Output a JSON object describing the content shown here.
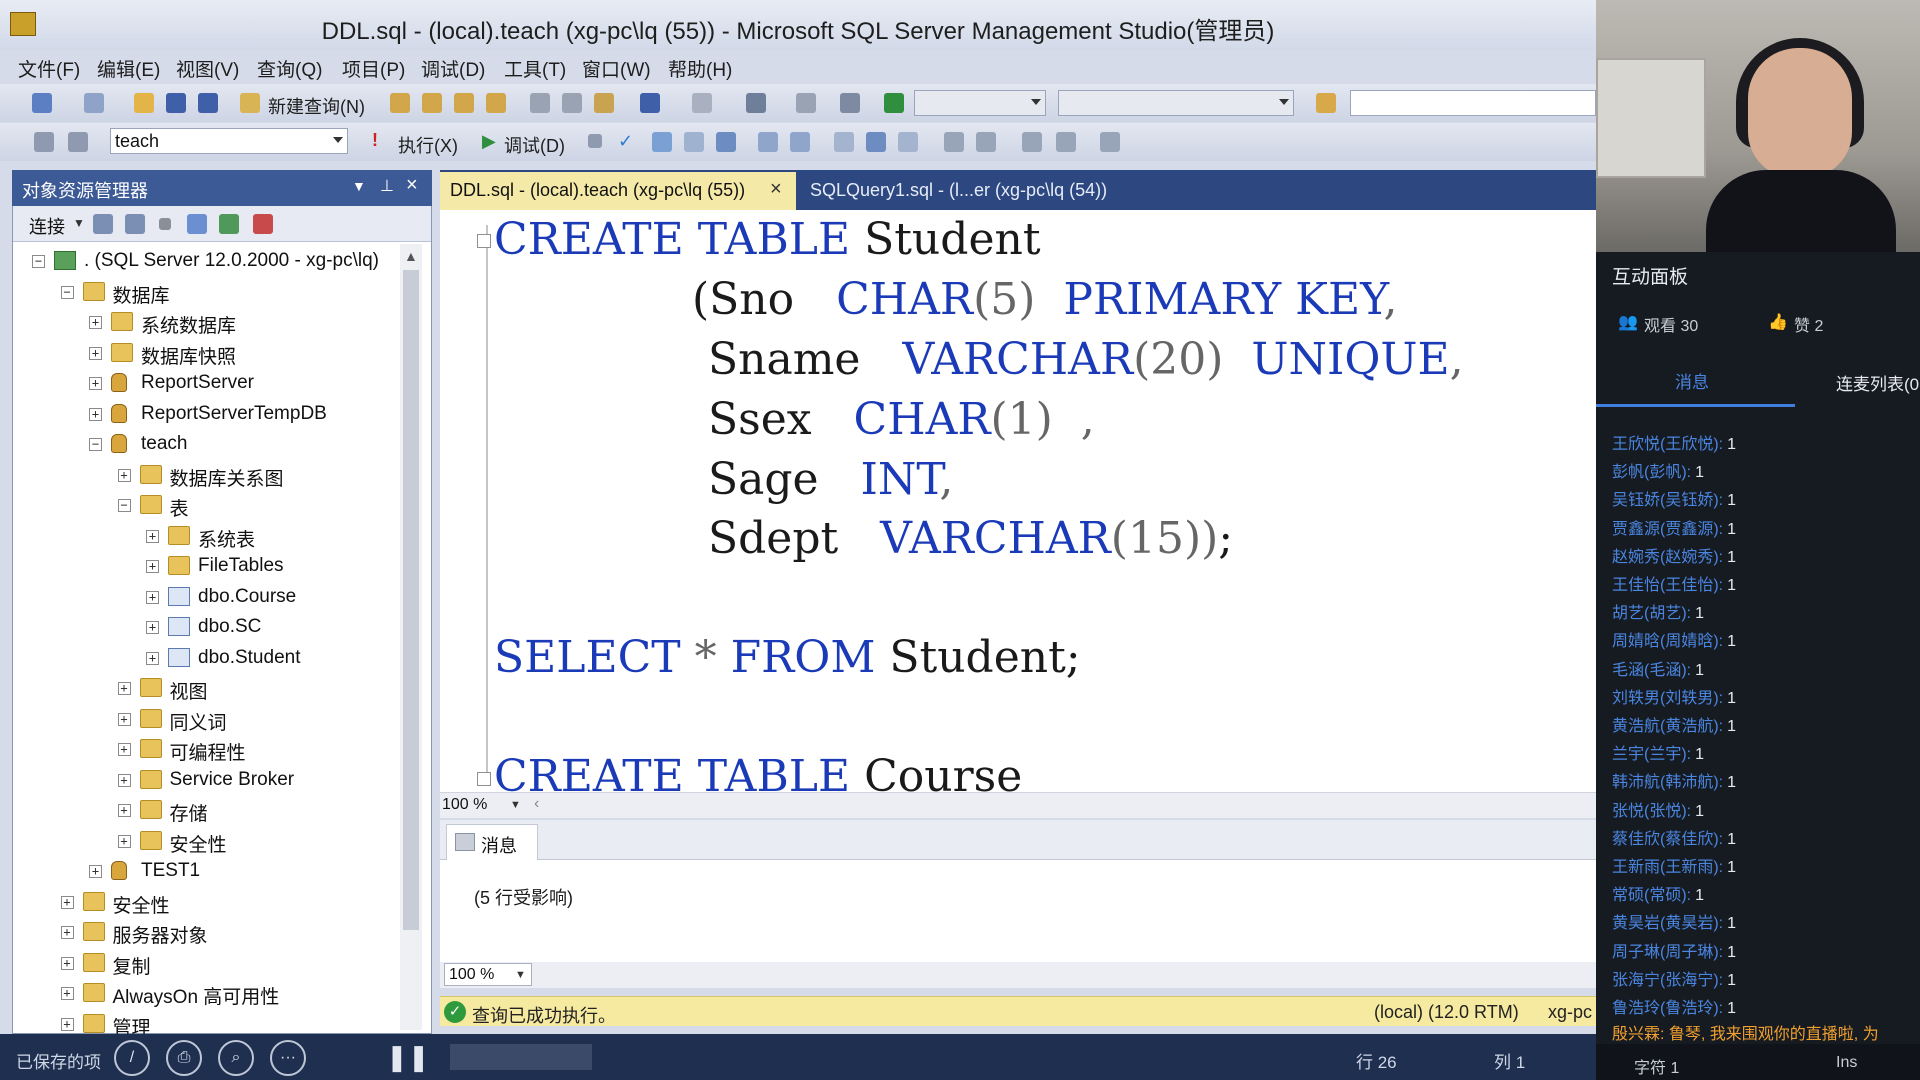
{
  "window": {
    "title": "DDL.sql - (local).teach (xg-pc\\lq (55)) - Microsoft SQL Server Management Studio(管理员)"
  },
  "menu": [
    "文件(F)",
    "编辑(E)",
    "视图(V)",
    "查询(Q)",
    "项目(P)",
    "调试(D)",
    "工具(T)",
    "窗口(W)",
    "帮助(H)"
  ],
  "toolbar": {
    "new_query_label": "新建查询(N)",
    "database": "teach",
    "execute_label": "执行(X)",
    "debug_label": "调试(D)"
  },
  "object_explorer": {
    "title": "对象资源管理器",
    "connect_label": "连接",
    "tree": [
      {
        "label": ". (SQL Server 12.0.2000 - xg-pc\\lq)",
        "expander": "⊟",
        "icon": "server"
      },
      {
        "label": "数据库",
        "expander": "⊟",
        "icon": "folder"
      },
      {
        "label": "系统数据库",
        "expander": "⊞",
        "icon": "folder"
      },
      {
        "label": "数据库快照",
        "expander": "⊞",
        "icon": "folder"
      },
      {
        "label": "ReportServer",
        "expander": "⊞",
        "icon": "db"
      },
      {
        "label": "ReportServerTempDB",
        "expander": "⊞",
        "icon": "db"
      },
      {
        "label": "teach",
        "expander": "⊟",
        "icon": "db"
      },
      {
        "label": "数据库关系图",
        "expander": "⊞",
        "icon": "folder"
      },
      {
        "label": "表",
        "expander": "⊟",
        "icon": "folder"
      },
      {
        "label": "系统表",
        "expander": "⊞",
        "icon": "folder"
      },
      {
        "label": "FileTables",
        "expander": "⊞",
        "icon": "folder"
      },
      {
        "label": "dbo.Course",
        "expander": "⊞",
        "icon": "table"
      },
      {
        "label": "dbo.SC",
        "expander": "⊞",
        "icon": "table"
      },
      {
        "label": "dbo.Student",
        "expander": "⊞",
        "icon": "table"
      },
      {
        "label": "视图",
        "expander": "⊞",
        "icon": "folder"
      },
      {
        "label": "同义词",
        "expander": "⊞",
        "icon": "folder"
      },
      {
        "label": "可编程性",
        "expander": "⊞",
        "icon": "folder"
      },
      {
        "label": "Service Broker",
        "expander": "⊞",
        "icon": "folder"
      },
      {
        "label": "存储",
        "expander": "⊞",
        "icon": "folder"
      },
      {
        "label": "安全性",
        "expander": "⊞",
        "icon": "folder"
      },
      {
        "label": "TEST1",
        "expander": "⊞",
        "icon": "db"
      },
      {
        "label": "安全性",
        "expander": "⊞",
        "icon": "folder"
      },
      {
        "label": "服务器对象",
        "expander": "⊞",
        "icon": "folder"
      },
      {
        "label": "复制",
        "expander": "⊞",
        "icon": "folder"
      },
      {
        "label": "AlwaysOn 高可用性",
        "expander": "⊞",
        "icon": "folder"
      },
      {
        "label": "管理",
        "expander": "⊞",
        "icon": "folder"
      }
    ]
  },
  "editor": {
    "tabs": [
      {
        "label": "DDL.sql - (local).teach (xg-pc\\lq (55))",
        "close": "×"
      },
      {
        "label": "SQLQuery1.sql - (l...er (xg-pc\\lq (54))"
      }
    ],
    "fold_markers": [
      "⊟",
      "⊟"
    ],
    "code": {
      "l1": {
        "kw1": "CREATE TABLE",
        "txt": " Student"
      },
      "l2": {
        "a": "(Sno   ",
        "kw1": "CHAR",
        "b": "(5)  ",
        "kw2": "PRIMARY KEY",
        "c": ","
      },
      "l3": {
        "a": "Sname   ",
        "kw1": "VARCHAR",
        "b": "(20)  ",
        "kw2": "UNIQUE",
        "c": ","
      },
      "l4": {
        "a": "Ssex   ",
        "kw1": "CHAR",
        "b": "(1)  ,"
      },
      "l5": {
        "a": "Sage   ",
        "kw1": "INT",
        "b": ","
      },
      "l6": {
        "a": "Sdept   ",
        "kw1": "VARCHAR",
        "b": "(15))",
        "c": ";"
      },
      "l7": {
        "kw1": "SELECT",
        "b": " * ",
        "kw2": "FROM",
        "c": " Student;"
      },
      "l8": {
        "kw1": "CREATE TABLE",
        "txt": " Course"
      }
    },
    "zoom": "100 %"
  },
  "results": {
    "tab_label": "消息",
    "message": "(5 行受影响)",
    "zoom": "100 %"
  },
  "statusbar": {
    "ok_icon": "✓",
    "message": "查询已成功执行。",
    "server": "(local) (12.0 RTM)",
    "user": "xg-pc"
  },
  "bottombar": {
    "saved_label": "已保存的项",
    "row": "行 26",
    "col": "列 1",
    "char": "字符 1",
    "ins": "Ins",
    "buttons": [
      "/",
      "⎙",
      "⌕",
      "···",
      "❚❚"
    ]
  },
  "live_panel": {
    "title": "互动面板",
    "viewers": "观看 30",
    "likes": "赞 2",
    "tab_messages": "消息",
    "tab_mic": "连麦列表(0",
    "messages": [
      {
        "name": "王欣悦(王欣悦):",
        "text": "1"
      },
      {
        "name": "彭帆(彭帆):",
        "text": "1"
      },
      {
        "name": "吴钰娇(吴钰娇):",
        "text": "1"
      },
      {
        "name": "贾鑫源(贾鑫源):",
        "text": "1"
      },
      {
        "name": "赵婉秀(赵婉秀):",
        "text": "1"
      },
      {
        "name": "王佳怡(王佳怡):",
        "text": "1"
      },
      {
        "name": "胡艺(胡艺):",
        "text": "1"
      },
      {
        "name": "周婧晗(周婧晗):",
        "text": "1"
      },
      {
        "name": "毛涵(毛涵):",
        "text": "1"
      },
      {
        "name": "刘轶男(刘轶男):",
        "text": "1"
      },
      {
        "name": "黄浩航(黄浩航):",
        "text": "1"
      },
      {
        "name": "兰宇(兰宇):",
        "text": "1"
      },
      {
        "name": "韩沛航(韩沛航):",
        "text": "1"
      },
      {
        "name": "张悦(张悦):",
        "text": "1"
      },
      {
        "name": "蔡佳欣(蔡佳欣):",
        "text": "1"
      },
      {
        "name": "王新雨(王新雨):",
        "text": "1"
      },
      {
        "name": "常硕(常硕):",
        "text": "1"
      },
      {
        "name": "黄昊岩(黄昊岩):",
        "text": "1"
      },
      {
        "name": "周子琳(周子琳):",
        "text": "1"
      },
      {
        "name": "张海宁(张海宁):",
        "text": "1"
      },
      {
        "name": "鲁浩玲(鲁浩玲):",
        "text": "1"
      }
    ],
    "system_message": {
      "name": "殷兴霖:",
      "text": "鲁琴, 我来围观你的直播啦, 为"
    }
  }
}
